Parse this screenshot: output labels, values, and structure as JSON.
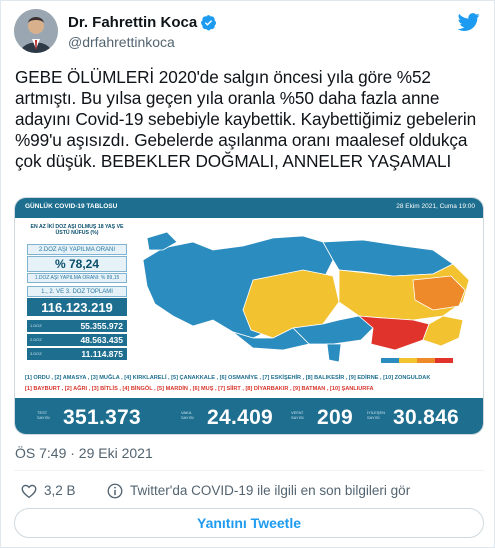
{
  "tweet": {
    "author": {
      "display_name": "Dr. Fahrettin Koca",
      "handle": "@drfahrettinkoca",
      "verified": true
    },
    "text": "GEBE ÖLÜMLERİ 2020'de salgın öncesi yıla göre %52 artmıştı. Bu yılsa geçen yıla oranla %50 daha fazla anne adayını Covid-19 sebebiyle kaybettik. Kaybettiğimiz gebelerin %99'u aşısızdı. Gebelerde aşılanma oranı maalesef oldukça çok düşük. BEBEKLER DOĞMALI, ANNELER YAŞAMALI",
    "timestamp": "ÖS 7:49 · 29 Eki 2021",
    "like_count": "3,2 B",
    "info_text": "Twitter'da COVID-19 ile ilgili en son bilgileri gör",
    "reply_label": "Yanıtını Tweetle"
  },
  "media": {
    "title": "GÜNLÜK COVID-19 TABLOSU",
    "date": "28 Ekim 2021, Cuma 19:00",
    "side_header": "EN AZ İKİ DOZ AŞI OLMUŞ 18 YAŞ VE ÜSTÜ NÜFUS (%)",
    "rate_label": "2.DOZ AŞI YAPILMA ORANI",
    "rate_value": "% 78,24",
    "rate_note": "1.DOZ AŞI YAPILMA ORANI: % 89,15",
    "total_label": "1., 2. VE 3. DOZ TOPLAMI",
    "total_value": "116.123.219",
    "dose1_label": "1.DOZ",
    "dose1_value": "55.355.972",
    "dose2_label": "2.DOZ",
    "dose2_value": "48.563.435",
    "dose3_label": "3.DOZ",
    "dose3_value": "11.114.875",
    "legend_blue": "[1] ORDU , [2] AMASYA , [3] MUĞLA , [4] KIRKLARELİ , [5] ÇANAKKALE , [6] OSMANİYE , [7] ESKİŞEHİR , [8] BALIKESİR , [9] EDİRNE , [10] ZONGULDAK",
    "legend_red": "[1] BAYBURT , [2] AĞRI , [3] BİTLİS , [4] BİNGÖL , [5] MARDİN , [6] MUŞ , [7] SİİRT , [8] DİYARBAKIR , [9] BATMAN , [10] ŞANLIURFA",
    "stats": [
      {
        "label": "TEST SAYISI",
        "value": "351.373"
      },
      {
        "label": "VAKA SAYISI",
        "value": "24.409"
      },
      {
        "label": "VEFAT SAYISI",
        "value": "209"
      },
      {
        "label": "İYİLEŞEN SAYISI",
        "value": "30.846"
      }
    ]
  },
  "colors": {
    "twitter_blue": "#1d9bf0",
    "map_blue": "#2b8cbf",
    "map_yellow": "#f2c230",
    "map_orange": "#ee8a2a",
    "map_red": "#e0332b",
    "panel_dark": "#1d6e8f"
  },
  "icons": [
    "avatar",
    "verified-badge-icon",
    "twitter-bird-icon",
    "heart-icon",
    "info-icon"
  ]
}
